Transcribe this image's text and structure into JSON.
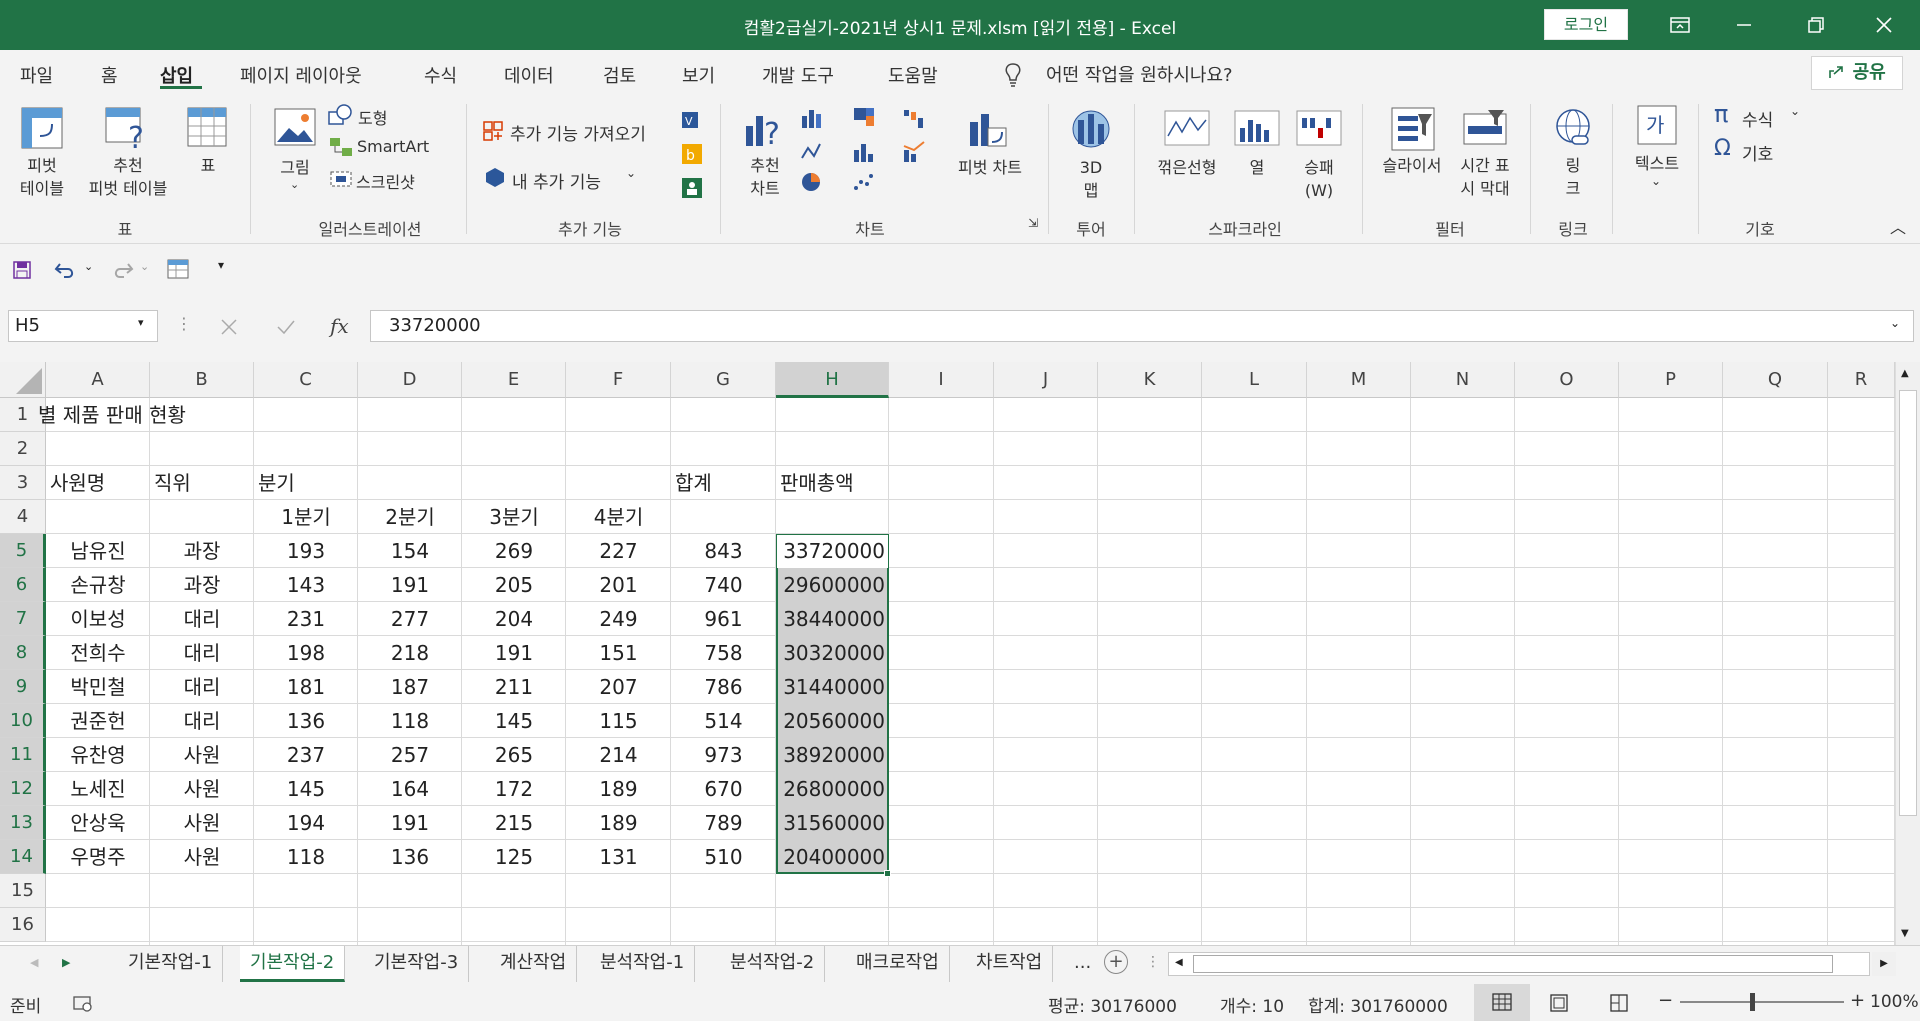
{
  "window": {
    "title": "컴활2급실기-2021년 상시1 문제.xlsm  [읽기 전용]  -  Excel",
    "login_label": "로그인"
  },
  "tabs": [
    "파일",
    "홈",
    "삽입",
    "페이지 레이아웃",
    "수식",
    "데이터",
    "검토",
    "보기",
    "개발 도구",
    "도움말"
  ],
  "active_tab": "삽입",
  "tell_me": "어떤 작업을 원하시나요?",
  "share_label": "공유",
  "ribbon": {
    "tables": {
      "pivot": "피벗\n테이블",
      "recommended_pivot": "추천\n피벗 테이블",
      "table": "표",
      "group": "표"
    },
    "illustrations": {
      "pictures": "그림",
      "shapes": "도형",
      "smartart": "SmartArt",
      "screenshot": "스크린샷",
      "group": "일러스트레이션"
    },
    "addins": {
      "get": "추가 기능 가져오기",
      "my": "내 추가 기능",
      "group": "추가 기능"
    },
    "charts": {
      "recommended": "추천\n차트",
      "pivot_chart": "피벗 차트",
      "group": "차트"
    },
    "tours": {
      "map3d": "3D\n맵",
      "group": "투어"
    },
    "sparklines": {
      "line": "꺾은선형",
      "column": "열",
      "winloss": "승패\n(W)",
      "group": "스파크라인"
    },
    "filters": {
      "slicer": "슬라이서",
      "timeline": "시간 표\n시 막대",
      "group": "필터"
    },
    "links": {
      "link": "링\n크",
      "group": "링크"
    },
    "text": {
      "text": "텍스트",
      "group": ""
    },
    "symbols": {
      "equation": "수식",
      "symbol": "기호",
      "group": "기호"
    }
  },
  "name_box": "H5",
  "formula_value": "33720000",
  "columns": [
    "A",
    "B",
    "C",
    "D",
    "E",
    "F",
    "G",
    "H",
    "I",
    "J",
    "K",
    "L",
    "M",
    "N",
    "O",
    "P",
    "Q",
    "R"
  ],
  "rows": [
    "1",
    "2",
    "3",
    "4",
    "5",
    "6",
    "7",
    "8",
    "9",
    "10",
    "11",
    "12",
    "13",
    "14",
    "15",
    "16"
  ],
  "sheet": {
    "title_fragment": "별 제품 판매 현황",
    "headers": {
      "name": "사원명",
      "position": "직위",
      "quarter": "분기",
      "total": "합계",
      "sales_total": "판매총액"
    },
    "quarters": [
      "1분기",
      "2분기",
      "3분기",
      "4분기"
    ],
    "records": [
      {
        "name": "남유진",
        "position": "과장",
        "q1": "193",
        "q2": "154",
        "q3": "269",
        "q4": "227",
        "sum": "843",
        "sales": "33720000"
      },
      {
        "name": "손규창",
        "position": "과장",
        "q1": "143",
        "q2": "191",
        "q3": "205",
        "q4": "201",
        "sum": "740",
        "sales": "29600000"
      },
      {
        "name": "이보성",
        "position": "대리",
        "q1": "231",
        "q2": "277",
        "q3": "204",
        "q4": "249",
        "sum": "961",
        "sales": "38440000"
      },
      {
        "name": "전희수",
        "position": "대리",
        "q1": "198",
        "q2": "218",
        "q3": "191",
        "q4": "151",
        "sum": "758",
        "sales": "30320000"
      },
      {
        "name": "박민철",
        "position": "대리",
        "q1": "181",
        "q2": "187",
        "q3": "211",
        "q4": "207",
        "sum": "786",
        "sales": "31440000"
      },
      {
        "name": "권준헌",
        "position": "대리",
        "q1": "136",
        "q2": "118",
        "q3": "145",
        "q4": "115",
        "sum": "514",
        "sales": "20560000"
      },
      {
        "name": "유찬영",
        "position": "사원",
        "q1": "237",
        "q2": "257",
        "q3": "265",
        "q4": "214",
        "sum": "973",
        "sales": "38920000"
      },
      {
        "name": "노세진",
        "position": "사원",
        "q1": "145",
        "q2": "164",
        "q3": "172",
        "q4": "189",
        "sum": "670",
        "sales": "26800000"
      },
      {
        "name": "안상욱",
        "position": "사원",
        "q1": "194",
        "q2": "191",
        "q3": "215",
        "q4": "189",
        "sum": "789",
        "sales": "31560000"
      },
      {
        "name": "우명주",
        "position": "사원",
        "q1": "118",
        "q2": "136",
        "q3": "125",
        "q4": "131",
        "sum": "510",
        "sales": "20400000"
      }
    ]
  },
  "sheet_tabs": [
    "기본작업-1",
    "기본작업-2",
    "기본작업-3",
    "계산작업",
    "분석작업-1",
    "분석작업-2",
    "매크로작업",
    "차트작업"
  ],
  "active_sheet": "기본작업-2",
  "more_sheets": "...",
  "status": {
    "ready": "준비",
    "average": "평균: 30176000",
    "count": "개수: 10",
    "sum": "합계: 301760000",
    "zoom": "100%"
  },
  "colors": {
    "accent": "#217346",
    "selection": "#d0d0d0"
  }
}
